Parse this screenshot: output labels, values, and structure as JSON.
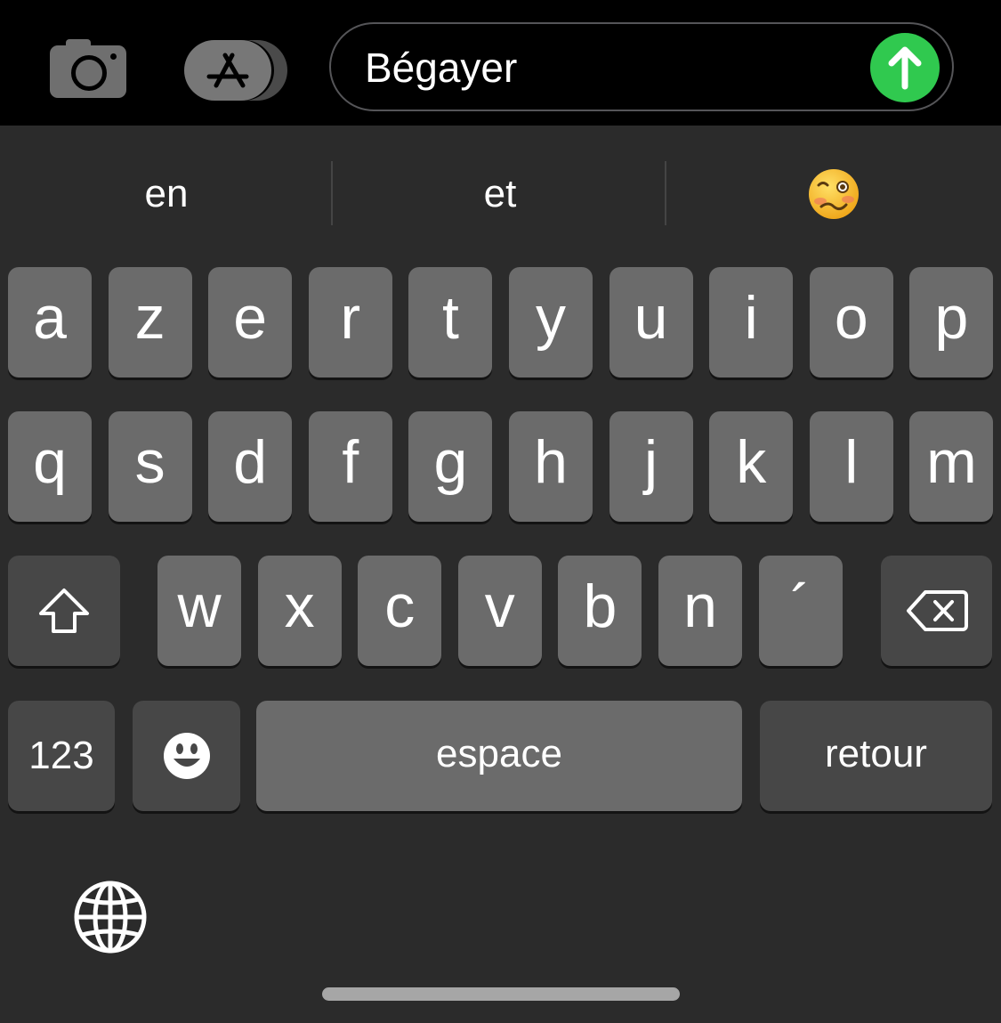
{
  "message_bar": {
    "camera_icon": "camera-icon",
    "apps_icon": "app-store-icon",
    "text_value": "Bégayer",
    "send_icon": "arrow-up-icon",
    "send_color": "#30c94f"
  },
  "suggestions": {
    "items": [
      {
        "label": "en"
      },
      {
        "label": "et"
      },
      {
        "label": "",
        "icon": "woozy-face-emoji"
      }
    ]
  },
  "keyboard": {
    "row1": [
      "a",
      "z",
      "e",
      "r",
      "t",
      "y",
      "u",
      "i",
      "o",
      "p"
    ],
    "row2": [
      "q",
      "s",
      "d",
      "f",
      "g",
      "h",
      "j",
      "k",
      "l",
      "m"
    ],
    "row3": [
      "w",
      "x",
      "c",
      "v",
      "b",
      "n",
      "´"
    ],
    "shift_icon": "shift-icon",
    "delete_icon": "delete-icon",
    "numbers_label": "123",
    "emoji_icon": "smiley-icon",
    "space_label": "espace",
    "return_label": "retour",
    "globe_icon": "globe-icon"
  },
  "colors": {
    "keyboard_bg": "#2b2b2b",
    "letter_key": "#6b6b6b",
    "function_key": "#474747",
    "top_bar": "#000000"
  }
}
